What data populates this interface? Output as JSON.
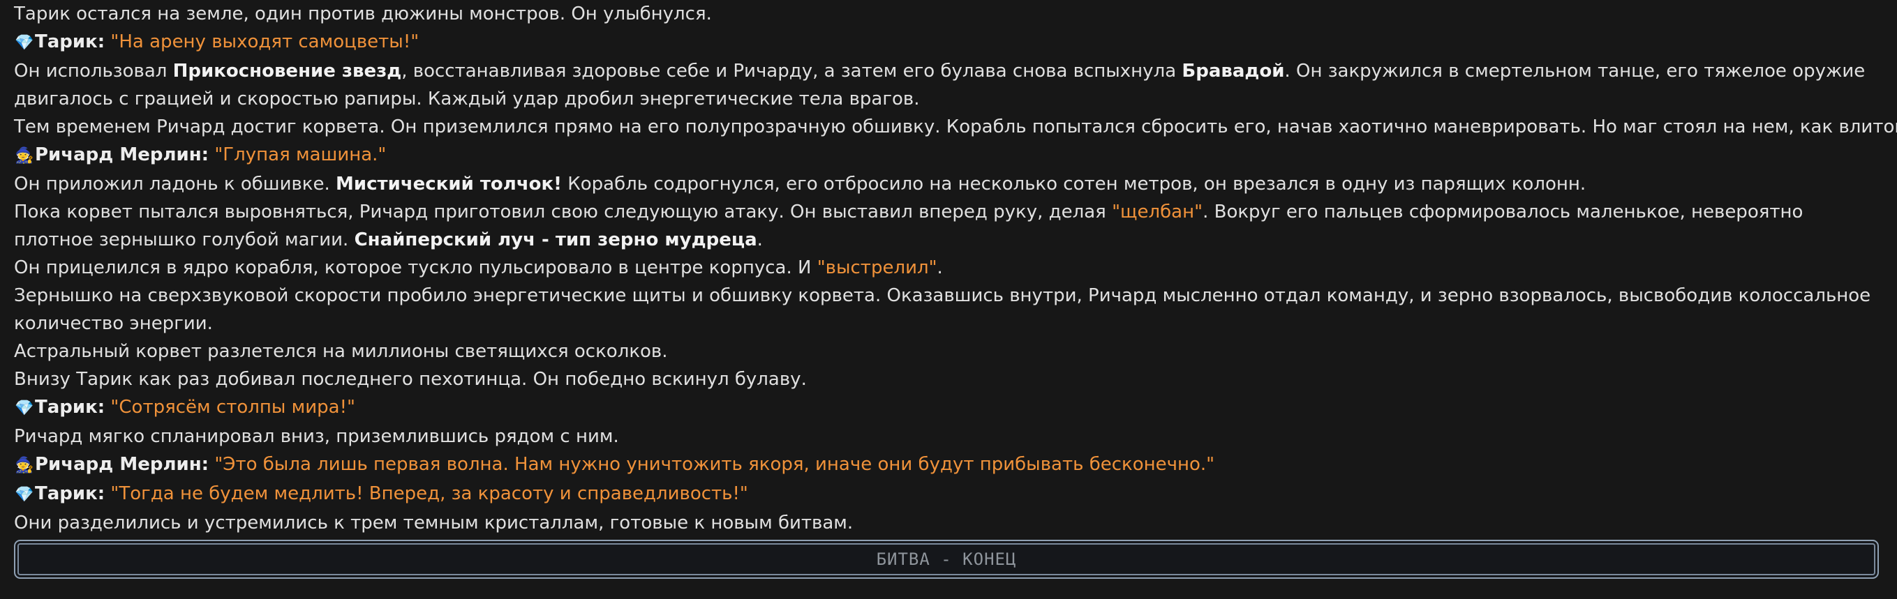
{
  "story": {
    "l1": "Тарик остался на земле, один против дюжины монстров. Он улыбнулся.",
    "l2": {
      "icon": "gem-icon",
      "speaker": "Тарик:",
      "quote": "\"На арену выходят самоцветы!\""
    },
    "l3": {
      "p1": "Он использовал ",
      "b1": "Прикосновение звезд",
      "p2": ", восстанавливая здоровье себе и Ричарду, а затем его булава снова вспыхнула ",
      "b2": "Бравадой",
      "p3": ". Он закружился в смертельном танце, его тяжелое оружие двигалось с грацией и скоростью рапиры. Каждый удар дробил энергетические тела врагов."
    },
    "l4": "Тем временем Ричард достиг корвета. Он приземлился прямо на его полупрозрачную обшивку. Корабль попытался сбросить его, начав хаотично маневрировать. Но маг стоял на нем, как влитой.",
    "l5": {
      "icon": "mage-icon",
      "speaker": "Ричард Мерлин:",
      "quote": "\"Глупая машина.\""
    },
    "l6": {
      "p1": "Он приложил ладонь к обшивке. ",
      "b1": "Мистический толчок!",
      "p2": " Корабль содрогнулся, его отбросило на несколько сотен метров, он врезался в одну из парящих колонн."
    },
    "l7": {
      "p1": "Пока корвет пытался выровняться, Ричард приготовил свою следующую атаку. Он выставил вперед руку, делая ",
      "q1": "\"щелбан\"",
      "p2": ". Вокруг его пальцев сформировалось маленькое, невероятно плотное зернышко голубой магии. ",
      "b1": "Снайперский луч - тип зерно мудреца",
      "p3": "."
    },
    "l8": {
      "p1": "Он прицелился в ядро корабля, которое тускло пульсировало в центре корпуса. И ",
      "q1": "\"выстрелил\"",
      "p2": "."
    },
    "l9": "Зернышко на сверхзвуковой скорости пробило энергетические щиты и обшивку корвета. Оказавшись внутри, Ричард мысленно отдал команду, и зерно взорвалось, высвободив колоссальное количество энергии.",
    "l10": "Астральный корвет разлетелся на миллионы светящихся осколков.",
    "l11": "Внизу Тарик как раз добивал последнего пехотинца. Он победно вскинул булаву.",
    "l12": {
      "icon": "gem-icon",
      "speaker": "Тарик:",
      "quote": "\"Сотрясём столпы мира!\""
    },
    "l13": "Ричард мягко спланировал вниз, приземлившись рядом с ним.",
    "l14": {
      "icon": "mage-icon",
      "speaker": "Ричард Мерлин:",
      "quote": "\"Это была лишь первая волна. Нам нужно уничтожить якоря, иначе они будут прибывать бесконечно.\""
    },
    "l15": {
      "icon": "gem-icon",
      "speaker": "Тарик:",
      "quote": "\"Тогда не будем медлить! Вперед, за красоту и справедливость!\""
    },
    "l16": "Они разделились и устремились к трем темным кристаллам, готовые к новым битвам."
  },
  "banner": {
    "text": "БИТВА - КОНЕЦ"
  },
  "colors": {
    "background": "#171717",
    "text": "#e0e0e0",
    "quote": "#f0923a",
    "banner_border": "#8fa0b3"
  }
}
